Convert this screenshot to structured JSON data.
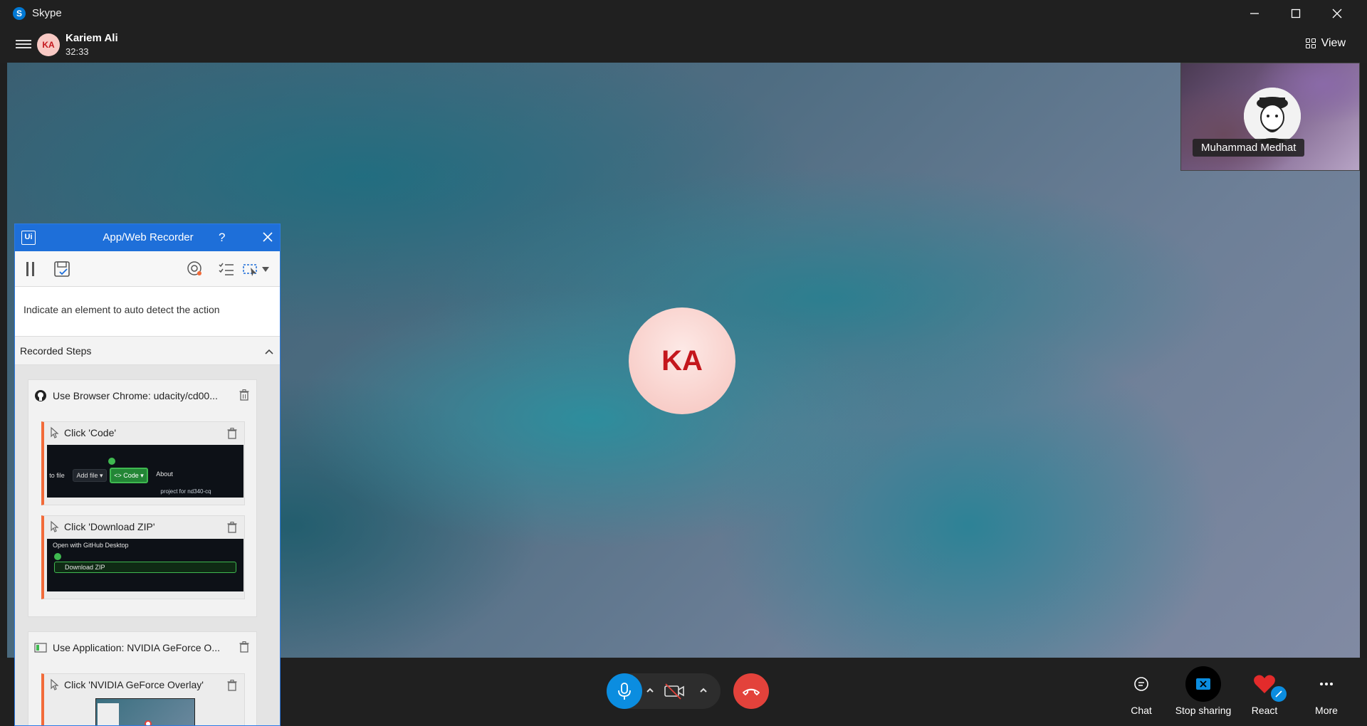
{
  "window": {
    "title": "Skype",
    "logo_letter": "S"
  },
  "call": {
    "caller_initials": "KA",
    "caller_name": "Kariem Ali",
    "timer": "32:33",
    "view_label": "View",
    "stage_initials": "KA",
    "self_view_name": "Muhammad Medhat"
  },
  "controls": {
    "chat_label": "Chat",
    "stop_sharing_label": "Stop sharing",
    "react_label": "React",
    "more_label": "More"
  },
  "recorder": {
    "logo_text": "Ui",
    "title": "App/Web Recorder",
    "help": "?",
    "hint": "Indicate an element to auto detect the action",
    "steps_header": "Recorded Steps",
    "groups": [
      {
        "title": "Use Browser Chrome: udacity/cd00...",
        "icon": "github-icon",
        "steps": [
          {
            "label": "Click 'Code'",
            "thumb": {
              "to_file": "to file",
              "add_file": "Add file ▾",
              "code": "<> Code ▾",
              "about": "About",
              "project": "project for nd340-cq"
            }
          },
          {
            "label": "Click 'Download ZIP'",
            "thumb": {
              "open_desktop": "Open with GitHub Desktop",
              "download_zip": "Download ZIP"
            }
          }
        ]
      },
      {
        "title": "Use Application: NVIDIA GeForce O...",
        "icon": "application-icon",
        "steps": [
          {
            "label": "Click 'NVIDIA GeForce Overlay'"
          }
        ]
      }
    ]
  },
  "colors": {
    "accent": "#1e6fd9",
    "mic": "#0b8de0",
    "hangup": "#e3423b",
    "step_marker": "#f26b3a",
    "avatar_text": "#c4161c"
  }
}
